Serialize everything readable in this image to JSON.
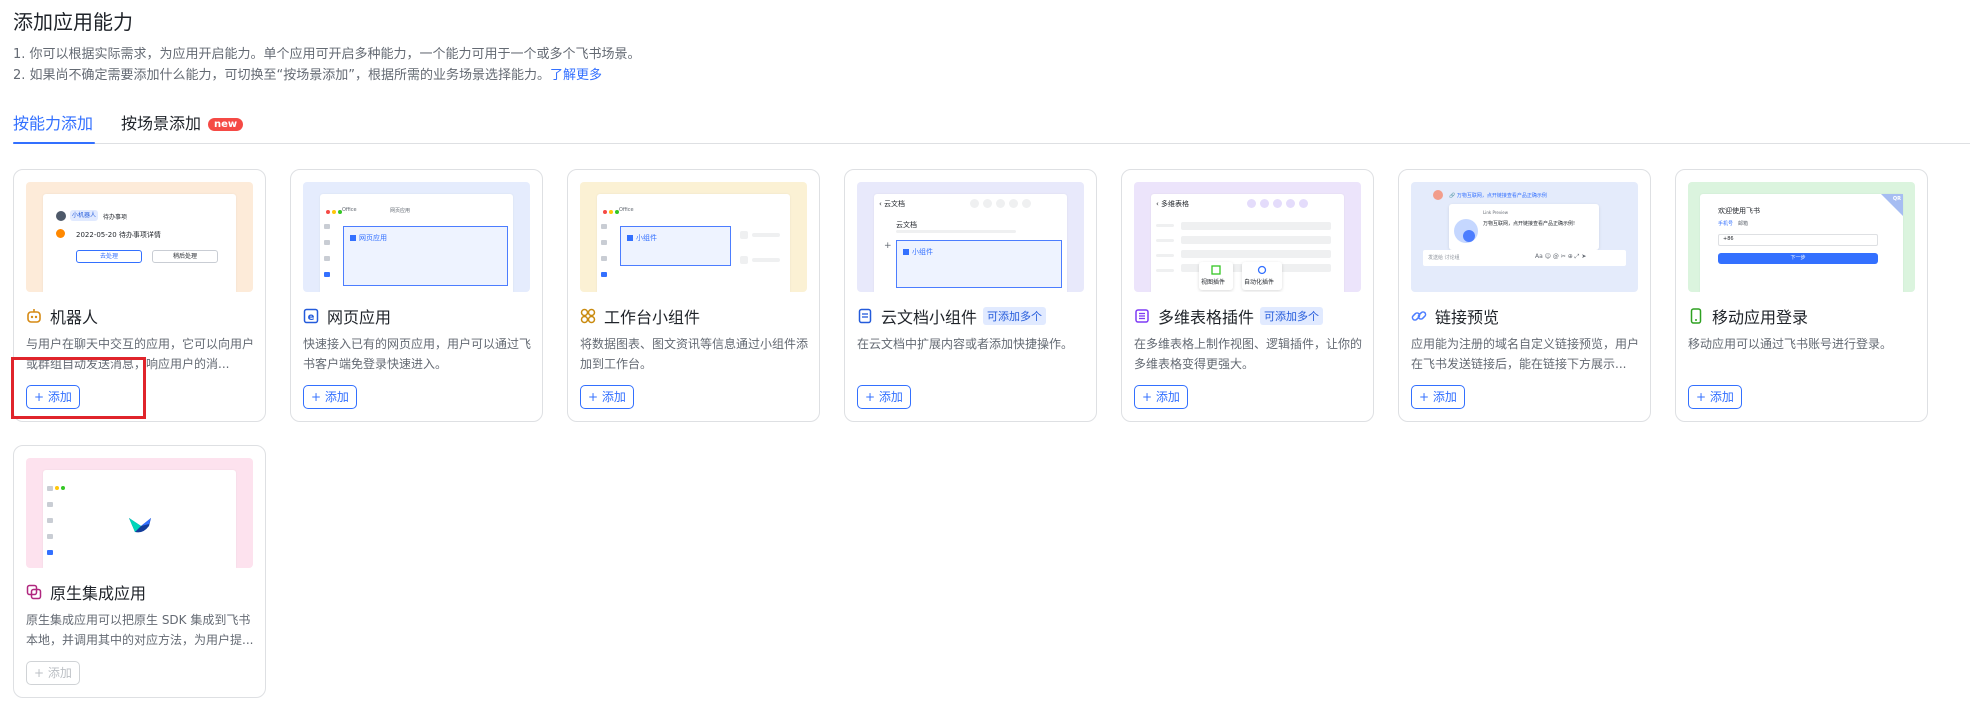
{
  "header": {
    "title": "添加应用能力",
    "desc1": "1. 你可以根据实际需求，为应用开启能力。单个应用可开启多种能力，一个能力可用于一个或多个飞书场景。",
    "desc2_prefix": "2. 如果尚不确定需要添加什么能力，可切换至“按场景添加”，根据所需的业务场景选择能力。",
    "desc2_link": "了解更多"
  },
  "tabs": {
    "by_ability": "按能力添加",
    "by_scenario": "按场景添加",
    "new_badge": "new"
  },
  "add_label": "+ 添加",
  "cards": [
    {
      "title": "机器人",
      "icon": "robot-icon",
      "desc": "与用户在聊天中交互的应用，它可以向用户或群组自动发送消息，响应用户的消...",
      "bg": "#fdebd9",
      "icon_color": "#d68a14"
    },
    {
      "title": "网页应用",
      "icon": "web-e-icon",
      "desc": "快速接入已有的网页应用，用户可以通过飞书客户端免登录快速进入。",
      "bg": "#e5ecfd",
      "icon_color": "#245bdb"
    },
    {
      "title": "工作台小组件",
      "icon": "widget-icon",
      "desc": "将数据图表、图文资讯等信息通过小组件添加到工作台。",
      "bg": "#fbf1d4",
      "icon_color": "#c98b10"
    },
    {
      "title": "云文档小组件",
      "icon": "doc-icon",
      "tag": "可添加多个",
      "desc": "在云文档中扩展内容或者添加快捷操作。",
      "bg": "#e8e9fb",
      "icon_color": "#245bdb"
    },
    {
      "title": "多维表格插件",
      "icon": "bitable-icon",
      "tag": "可添加多个",
      "desc": "在多维表格上制作视图、逻辑插件，让你的多维表格变得更强大。",
      "bg": "#ece4fb",
      "icon_color": "#7f3bf5"
    },
    {
      "title": "链接预览",
      "icon": "link-icon",
      "desc": "应用能为注册的域名自定义链接预览，用户在飞书发送链接后，能在链接下方展示...",
      "bg": "#e4ebfb",
      "icon_color": "#4c7dff"
    },
    {
      "title": "移动应用登录",
      "icon": "mobile-icon",
      "desc": "移动应用可以通过飞书账号进行登录。",
      "bg": "#dbf4de",
      "icon_color": "#2ea121"
    },
    {
      "title": "原生集成应用",
      "icon": "native-icon",
      "desc": "原生集成应用可以把原生 SDK 集成到飞书本地，并调用其中的对应方法，为用户提...",
      "bg": "#fde2ee",
      "icon_color": "#b0277f",
      "disabled": true
    }
  ],
  "thumbs": {
    "robot": {
      "bot_name": "小机器人",
      "todo": "待办事项",
      "date_line": "2022-05-20 待办事项详情",
      "btn1": "去处理",
      "btn2": "稍后处理"
    },
    "web": {
      "tab1": "Office",
      "tab2": "网页应用",
      "box": "网页应用"
    },
    "widget": {
      "tab1": "Office",
      "box": "小组件"
    },
    "doc": {
      "back": "云文档",
      "doc_title": "云文档",
      "box": "小组件"
    },
    "bitable": {
      "back": "多维表格",
      "btn1": "视图插件",
      "btn2": "自动化插件"
    },
    "link": {
      "link_text": "万物互联网，点开链接查看产品正确示例",
      "card_text": "万物互联网，点开链接查看产品正确示例!",
      "sub": "Link Preview",
      "input": "发送给 讨论组"
    },
    "mobile": {
      "welcome": "欢迎使用飞书",
      "tab1": "手机号",
      "tab2": "邮箱",
      "code": "+86",
      "btn": "下一步",
      "corner": "QR"
    }
  }
}
